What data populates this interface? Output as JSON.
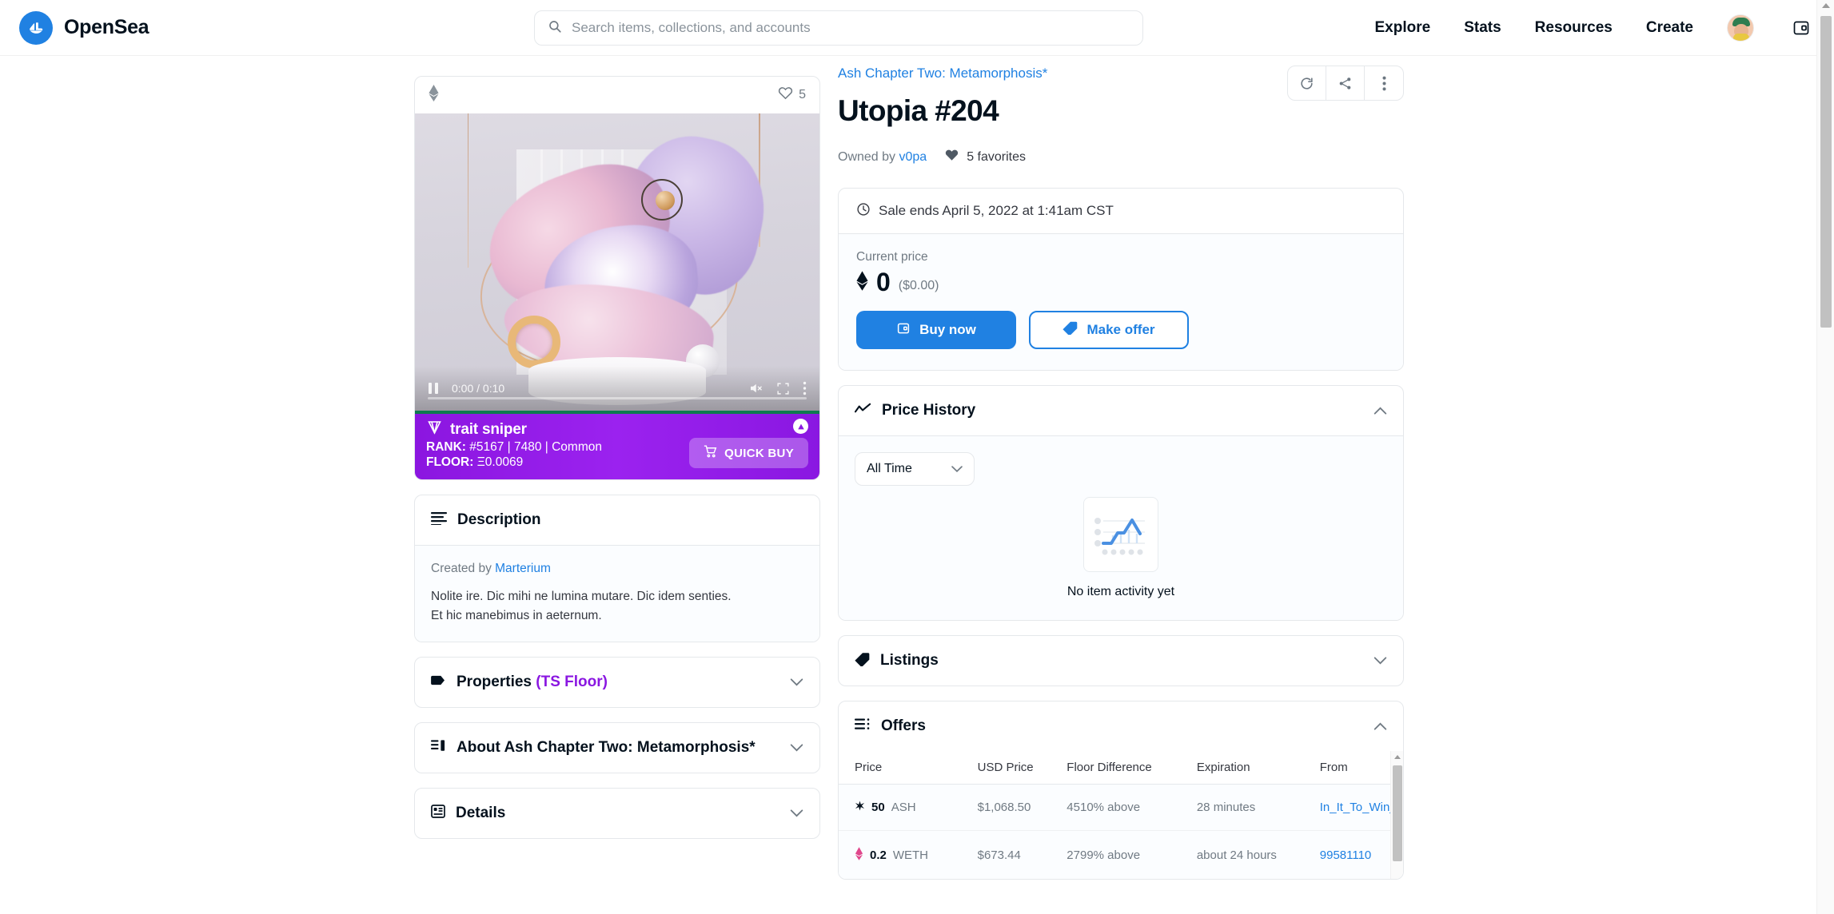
{
  "header": {
    "brand_name": "OpenSea",
    "brand_logo_icon": "opensea-ship-logo",
    "search": {
      "placeholder": "Search items, collections, and accounts",
      "value": "",
      "icon": "search-icon"
    },
    "nav": [
      {
        "label": "Explore"
      },
      {
        "label": "Stats"
      },
      {
        "label": "Resources"
      },
      {
        "label": "Create"
      }
    ],
    "avatar_icon": "user-avatar",
    "wallet_icon": "wallet-icon"
  },
  "nft_card": {
    "chain_icon": "ethereum-icon",
    "favorites_count": "5",
    "heart_icon": "heart-outline-icon",
    "video": {
      "play_pause_icon": "pause-icon",
      "time": "0:00 / 0:10",
      "mute_icon": "mute-icon",
      "fullscreen_icon": "fullscreen-icon",
      "more_icon": "more-vertical-icon"
    }
  },
  "trait_sniper": {
    "logo_icon": "diamond-icon",
    "title": "trait sniper",
    "rank_label": "RANK:",
    "rank_value": "#5167 | 7480 | Common",
    "floor_label": "FLOOR:",
    "floor_value": "Ξ0.0069",
    "quick_buy_label": "QUICK BUY",
    "quick_buy_icon": "cart-icon",
    "badge_icon": "triangle-up-icon",
    "bg_color": "#9b22ef",
    "accent_bar_color": "#0e7a4f"
  },
  "description_panel": {
    "title": "Description",
    "icon": "lines-icon",
    "created_by_label": "Created by",
    "creator": "Marterium",
    "body_line_1": "Nolite ire. Dic mihi ne lumina mutare. Dic idem senties.",
    "body_line_2": "Et hic manebimus in aeternum."
  },
  "accordions": [
    {
      "title": "Properties",
      "accent": "(TS Floor)",
      "icon": "tag-icon",
      "expanded": false
    },
    {
      "title": "About Ash Chapter Two: Metamorphosis*",
      "accent": "",
      "icon": "list-icon",
      "expanded": false
    },
    {
      "title": "Details",
      "accent": "",
      "icon": "details-grid-icon",
      "expanded": false
    }
  ],
  "item": {
    "collection": "Ash Chapter Two: Metamorphosis*",
    "title": "Utopia #204",
    "owned_by_label": "Owned by",
    "owner": "v0pa",
    "favorites_text": "5 favorites",
    "favorites_icon": "heart-filled-icon",
    "actions": [
      {
        "icon": "refresh-icon"
      },
      {
        "icon": "share-icon"
      },
      {
        "icon": "more-vertical-icon"
      }
    ]
  },
  "sale": {
    "clock_icon": "clock-icon",
    "ends_text": "Sale ends April 5, 2022 at 1:41am CST",
    "current_price_label": "Current price",
    "eth_icon": "ethereum-icon",
    "price": "0",
    "price_usd": "($0.00)",
    "buy_now_label": "Buy now",
    "buy_now_icon": "wallet-icon",
    "make_offer_label": "Make offer",
    "make_offer_icon": "tag-icon",
    "primary_color": "#2081e2"
  },
  "price_history": {
    "title": "Price History",
    "icon": "chart-line-icon",
    "expanded": true,
    "chevron": "chevron-up-icon",
    "filter_value": "All Time",
    "filter_chevron": "chevron-down-icon",
    "empty_icon": "empty-chart-icon",
    "empty_text": "No item activity yet"
  },
  "listings": {
    "title": "Listings",
    "icon": "tag-icon",
    "expanded": false,
    "chevron": "chevron-down-icon"
  },
  "offers": {
    "title": "Offers",
    "icon": "list-icon",
    "expanded": true,
    "chevron": "chevron-up-icon",
    "columns": [
      "Price",
      "USD Price",
      "Floor Difference",
      "Expiration",
      "From"
    ],
    "rows": [
      {
        "currency_icon": "ash-token-icon",
        "amount": "50",
        "unit": "ASH",
        "usd_price": "$1,068.50",
        "floor_difference": "4510% above",
        "expiration": "28 minutes",
        "from": "In_It_To_Win_It"
      },
      {
        "currency_icon": "weth-token-icon",
        "amount": "0.2",
        "unit": "WETH",
        "usd_price": "$673.44",
        "floor_difference": "2799% above",
        "expiration": "about 24 hours",
        "from": "99581110"
      }
    ]
  },
  "chart_data": {
    "type": "line",
    "title": "Price History",
    "series": [],
    "categories": [],
    "values": [],
    "xlabel": "",
    "ylabel": "",
    "note": "No item activity yet"
  }
}
